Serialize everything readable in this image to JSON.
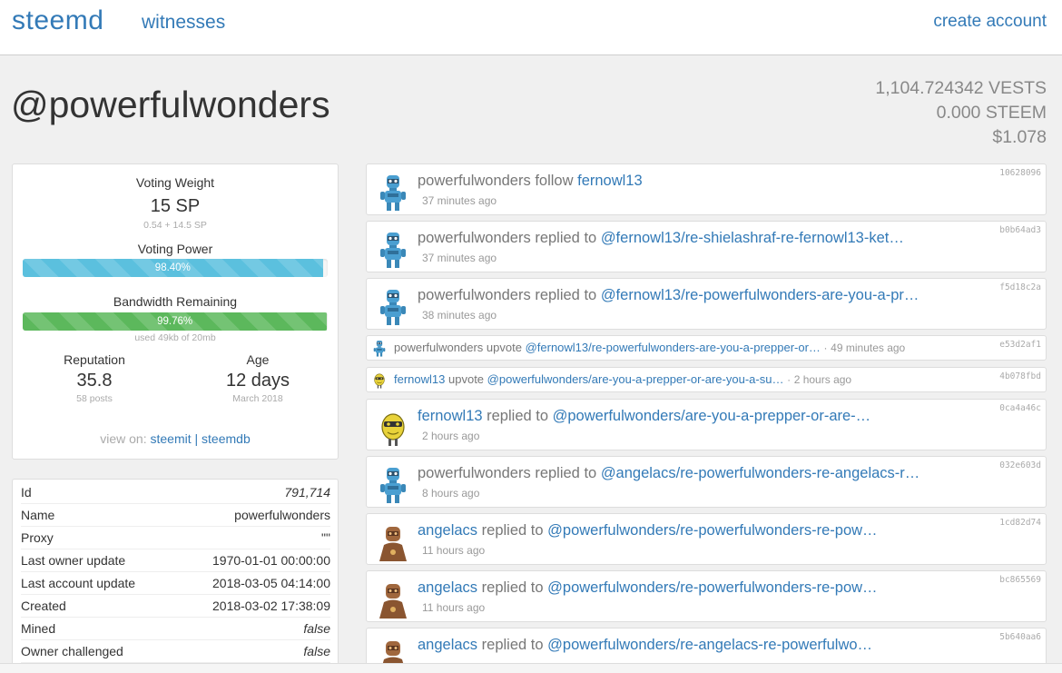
{
  "nav": {
    "brand": "steemd",
    "witnesses": "witnesses",
    "create_account": "create account"
  },
  "account": {
    "name": "@powerfulwonders"
  },
  "balances": {
    "vests": "1,104.724342 VESTS",
    "steem": "0.000 STEEM",
    "usd": "$1.078"
  },
  "stats": {
    "voting_weight_label": "Voting Weight",
    "voting_weight": "15 SP",
    "voting_weight_detail": "0.54 + 14.5 SP",
    "voting_power_label": "Voting Power",
    "voting_power_text": "98.40%",
    "voting_power_fraction": 0.984,
    "bandwidth_label": "Bandwidth Remaining",
    "bandwidth_text": "99.76%",
    "bandwidth_fraction": 0.9976,
    "bandwidth_detail": "used 49kb of 20mb",
    "reputation_label": "Reputation",
    "reputation": "35.8",
    "posts": "58 posts",
    "age_label": "Age",
    "age": "12 days",
    "age_date": "March 2018",
    "view_on": "view on:",
    "steemit": "steemit",
    "sep": "|",
    "steemdb": "steemdb"
  },
  "properties": [
    {
      "key": "Id",
      "value": "791,714",
      "italic": true
    },
    {
      "key": "Name",
      "value": "powerfulwonders",
      "italic": false
    },
    {
      "key": "Proxy",
      "value": "\"\"",
      "italic": false
    },
    {
      "key": "Last owner update",
      "value": "1970-01-01 00:00:00",
      "italic": false
    },
    {
      "key": "Last account update",
      "value": "2018-03-05 04:14:00",
      "italic": false
    },
    {
      "key": "Created",
      "value": "2018-03-02 17:38:09",
      "italic": false
    },
    {
      "key": "Mined",
      "value": "false",
      "italic": true
    },
    {
      "key": "Owner challenged",
      "value": "false",
      "italic": true
    }
  ],
  "feed": [
    {
      "actor": "powerfulwonders",
      "verb": "follow",
      "target": "fernowl13",
      "time": "37 minutes ago",
      "hash": "10628096",
      "avatar": "robot-blue-icon"
    },
    {
      "actor": "powerfulwonders",
      "verb": "replied to",
      "target": "@fernowl13/re-shielashraf-re-fernowl13-ket…",
      "time": "37 minutes ago",
      "hash": "b0b64ad3",
      "avatar": "robot-blue-icon"
    },
    {
      "actor": "powerfulwonders",
      "verb": "replied to",
      "target": "@fernowl13/re-powerfulwonders-are-you-a-pr…",
      "time": "38 minutes ago",
      "hash": "f5d18c2a",
      "avatar": "robot-blue-icon"
    },
    {
      "actor": "powerfulwonders",
      "verb": "upvote",
      "target": "@fernowl13/re-powerfulwonders-are-you-a-prepper-or…",
      "time": "49 minutes ago",
      "hash": "e53d2af1",
      "avatar": "robot-blue-icon"
    },
    {
      "actor": "fernowl13",
      "verb": "upvote",
      "target": "@powerfulwonders/are-you-a-prepper-or-are-you-a-su…",
      "time": "2 hours ago",
      "hash": "4b078fbd",
      "avatar": "robot-yellow-icon"
    },
    {
      "actor": "fernowl13",
      "verb": "replied to",
      "target": "@powerfulwonders/are-you-a-prepper-or-are-…",
      "time": "2 hours ago",
      "hash": "0ca4a46c",
      "avatar": "robot-yellow-icon"
    },
    {
      "actor": "powerfulwonders",
      "verb": "replied to",
      "target": "@angelacs/re-powerfulwonders-re-angelacs-r…",
      "time": "8 hours ago",
      "hash": "032e603d",
      "avatar": "robot-blue-icon"
    },
    {
      "actor": "angelacs",
      "verb": "replied to",
      "target": "@powerfulwonders/re-powerfulwonders-re-pow…",
      "time": "11 hours ago",
      "hash": "1cd82d74",
      "avatar": "robot-brown-icon"
    },
    {
      "actor": "angelacs",
      "verb": "replied to",
      "target": "@powerfulwonders/re-powerfulwonders-re-pow…",
      "time": "11 hours ago",
      "hash": "bc865569",
      "avatar": "robot-brown-icon"
    },
    {
      "actor": "angelacs",
      "verb": "replied to",
      "target": "@powerfulwonders/re-angelacs-re-powerfulwo…",
      "time": "",
      "hash": "5b640aa6",
      "avatar": "robot-brown-icon"
    }
  ]
}
